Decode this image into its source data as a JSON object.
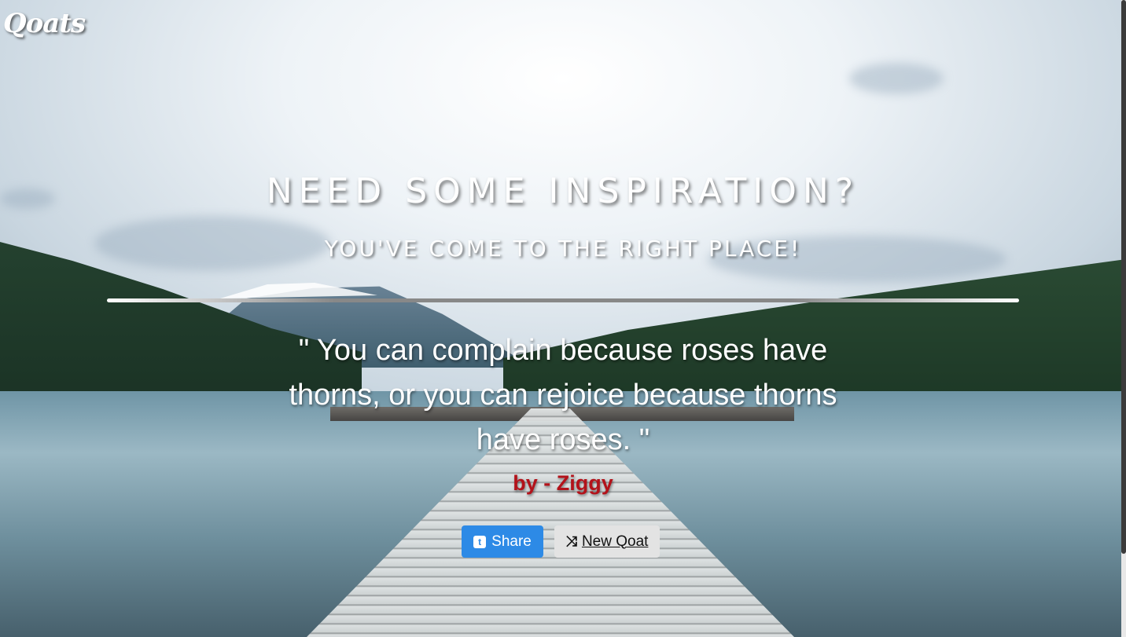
{
  "brand": {
    "logo": "Qoats"
  },
  "hero": {
    "headline": "NEED SOME INSPIRATION?",
    "subheadline": "YOU'VE COME TO THE RIGHT PLACE!"
  },
  "quote": {
    "text": "\" You can complain because roses have thorns, or you can rejoice because thorns have roses. \"",
    "author": "by - Ziggy"
  },
  "actions": {
    "share_label": "Share",
    "new_label": "New Qoat"
  },
  "icons": {
    "share": "twitter-square-icon",
    "new": "shuffle-icon"
  },
  "colors": {
    "share_button": "#2d8ae6",
    "new_button": "#e3e3e3",
    "author_text": "#b3121a"
  }
}
